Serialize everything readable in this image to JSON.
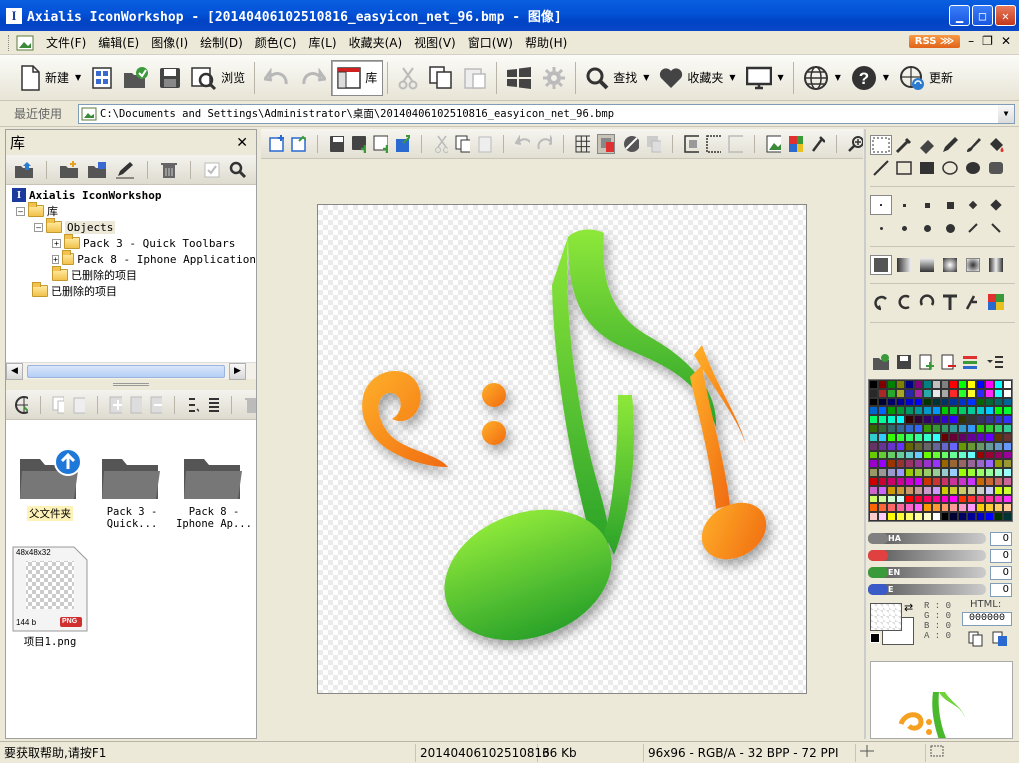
{
  "window": {
    "title": "Axialis IconWorkshop - [20140406102510816_easyicon_net_96.bmp - 图像]",
    "app_icon_letter": "I"
  },
  "menu": {
    "items": [
      "文件(F)",
      "编辑(E)",
      "图像(I)",
      "绘制(D)",
      "颜色(C)",
      "库(L)",
      "收藏夹(A)",
      "视图(V)",
      "窗口(W)",
      "帮助(H)"
    ],
    "rss": "RSS"
  },
  "toolbar": {
    "new_label": "新建",
    "browse_label": "浏览",
    "library_label": "库",
    "find_label": "查找",
    "favorites_label": "收藏夹",
    "update_label": "更新"
  },
  "address": {
    "label": "最近使用",
    "path": "C:\\Documents and Settings\\Administrator\\桌面\\20140406102510816_easyicon_net_96.bmp"
  },
  "library": {
    "title": "库",
    "tree": {
      "root": "Axialis IconWorkshop",
      "lib": "库",
      "objects": "Objects",
      "pack3": "Pack 3 - Quick Toolbars",
      "pack8": "Pack 8 - Iphone Application",
      "deleted_inner": "已删除的项目",
      "deleted_outer": "已删除的项目"
    },
    "items": {
      "parent_folder": "父文件夹",
      "pack3_line1": "Pack 3 -",
      "pack3_line2": "Quick...",
      "pack8_line1": "Pack 8 -",
      "pack8_line2": "Iphone Ap...",
      "file_size_label": "48x48x32",
      "file_bytes": "144 b",
      "file_badge": "PNG",
      "file_name": "项目1.png"
    }
  },
  "color_panel": {
    "sliders": [
      {
        "label": "HA",
        "value": "0",
        "color": "#808080"
      },
      {
        "label": "",
        "value": "0",
        "color": "#e04040"
      },
      {
        "label": "EN",
        "value": "0",
        "color": "#3a9a3a"
      },
      {
        "label": "E",
        "value": "0",
        "color": "#3a5ac8"
      }
    ],
    "r_label": "R : 0",
    "g_label": "G : 0",
    "b_label": "B : 0",
    "a_label": "A : 0",
    "html_label": "HTML:",
    "html_value": "000000"
  },
  "status": {
    "help": "要获取帮助,请按F1",
    "file": "20140406102510816",
    "size": "36 Kb",
    "info": "96x96 - RGB/A - 32 BPP - 72 PPI"
  },
  "colors": {
    "title_blue": "#0353d8",
    "music_green": "#3cb83c",
    "music_orange": "#f58a1c"
  }
}
